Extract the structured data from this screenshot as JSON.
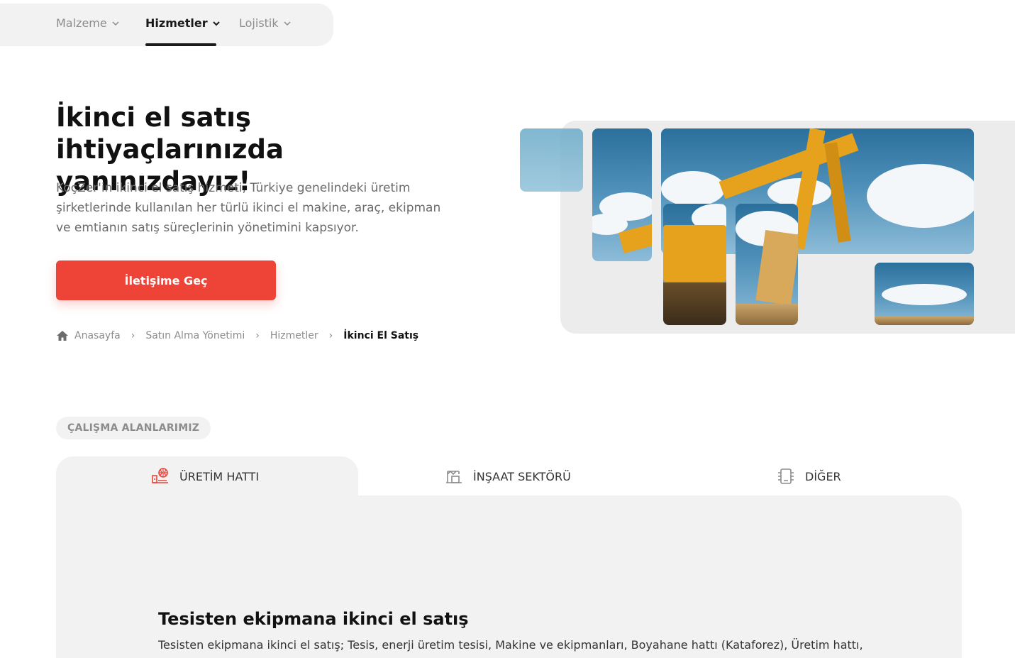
{
  "nav": {
    "items": [
      {
        "label": "Malzeme",
        "active": false
      },
      {
        "label": "Hizmetler",
        "active": true
      },
      {
        "label": "Lojistik",
        "active": false
      }
    ]
  },
  "hero": {
    "title": "İkinci el satış ihtiyaçlarınızda yanınızdayız!",
    "description": "KoçZer'in ikinci el satış hizmeti, Türkiye genelindeki üretim şirketlerinde kullanılan her türlü ikinci el makine, araç, ekipman ve emtianın satış süreçlerinin yönetimini kapsıyor.",
    "cta_label": "İletişime Geç"
  },
  "breadcrumb": {
    "items": [
      "Anasayfa",
      "Satın Alma Yönetimi",
      "Hizmetler"
    ],
    "current": "İkinci El Satış"
  },
  "section": {
    "tag": "ÇALIŞMA ALANLARIMIZ"
  },
  "tabs": [
    {
      "label": "ÜRETİM HATTI",
      "icon": "production-line-icon",
      "active": true
    },
    {
      "label": "İNŞAAT SEKTÖRÜ",
      "icon": "construction-icon",
      "active": false
    },
    {
      "label": "DİĞER",
      "icon": "other-icon",
      "active": false
    }
  ],
  "panel": {
    "title": "Tesisten ekipmana ikinci el satış",
    "text": "Tesisten ekipmana ikinci el satış; Tesis, enerji üretim tesisi, Makine ve ekipmanları, Boyahane hattı (Kataforez), Üretim hattı,"
  },
  "colors": {
    "accent": "#ee4337",
    "panel_bg": "#f2f2f3",
    "muted_text": "#8c8c8c"
  }
}
